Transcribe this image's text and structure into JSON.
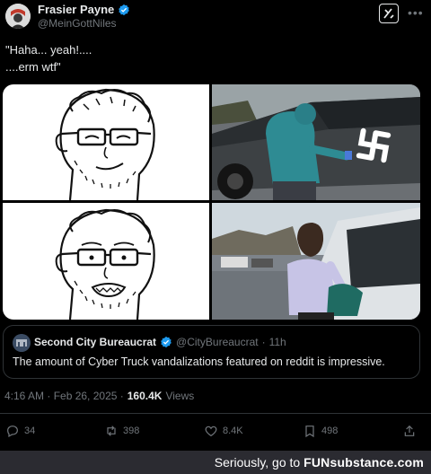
{
  "post": {
    "author_name": "Frasier Payne",
    "author_handle": "@MeinGottNiles",
    "text_lines": [
      "\"Haha... yeah!....",
      "....erm wtf\""
    ],
    "timestamp": "4:16 AM · Feb 26, 2025 ·",
    "views_count": "160.4K",
    "views_label": "Views"
  },
  "quote": {
    "author_name": "Second City Bureaucrat",
    "author_handle": "@CityBureaucrat",
    "separator": "·",
    "time": "11h",
    "text": "The amount of Cyber Truck vandalizations featured on reddit is impressive."
  },
  "actions": {
    "replies": "34",
    "reposts": "398",
    "likes": "8.4K",
    "bookmarks": "498"
  },
  "footer": {
    "prefix": "Seriously, go to",
    "brand": "FUNsubstance.com"
  },
  "colors": {
    "verified": "#1d9bf0",
    "muted": "#71767b",
    "text": "#e7e9ea",
    "border": "#2f3336"
  }
}
